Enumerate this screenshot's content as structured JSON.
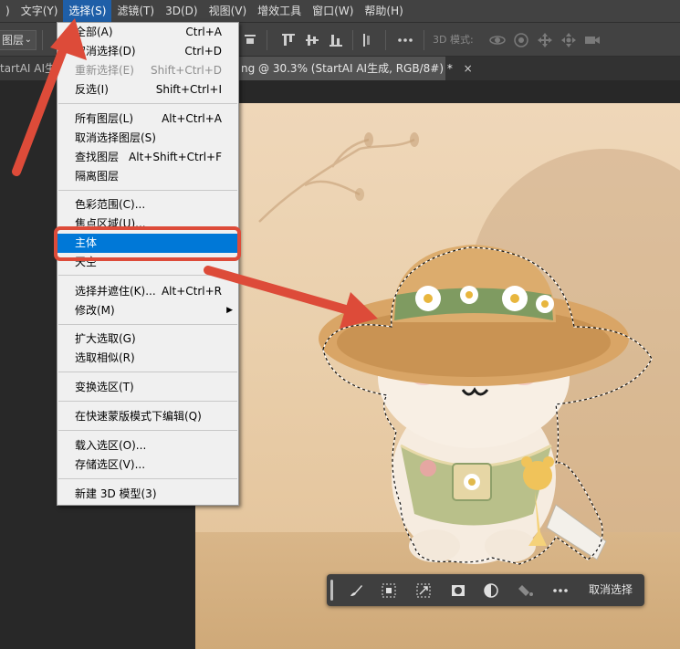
{
  "menubar": {
    "items": [
      {
        "label": ")"
      },
      {
        "label": "文字(Y)"
      },
      {
        "label": "选择(S)"
      },
      {
        "label": "滤镜(T)"
      },
      {
        "label": "3D(D)"
      },
      {
        "label": "视图(V)"
      },
      {
        "label": "增效工具"
      },
      {
        "label": "窗口(W)"
      },
      {
        "label": "帮助(H)"
      }
    ]
  },
  "options_bar": {
    "layer_select": "图层",
    "mode_3d_label": "3D 模式:"
  },
  "tabs": [
    {
      "label": "tartAI AI生"
    },
    {
      "label": "ng @ 30.3% (StartAI AI生成, RGB/8#) *",
      "close": "×"
    }
  ],
  "select_menu": {
    "items": [
      {
        "label": "全部(A)",
        "shortcut": "Ctrl+A"
      },
      {
        "label": "取消选择(D)",
        "shortcut": "Ctrl+D"
      },
      {
        "label": "重新选择(E)",
        "shortcut": "Shift+Ctrl+D"
      },
      {
        "label": "反选(I)",
        "shortcut": "Shift+Ctrl+I"
      },
      {
        "label": "所有图层(L)",
        "shortcut": "Alt+Ctrl+A"
      },
      {
        "label": "取消选择图层(S)",
        "shortcut": ""
      },
      {
        "label": "查找图层",
        "shortcut": "Alt+Shift+Ctrl+F"
      },
      {
        "label": "隔离图层",
        "shortcut": ""
      },
      {
        "label": "色彩范围(C)...",
        "shortcut": ""
      },
      {
        "label": "焦点区域(U)...",
        "shortcut": ""
      },
      {
        "label": "主体",
        "shortcut": ""
      },
      {
        "label": "天空",
        "shortcut": ""
      },
      {
        "label": "选择并遮住(K)...",
        "shortcut": "Alt+Ctrl+R"
      },
      {
        "label": "修改(M)",
        "shortcut": ""
      },
      {
        "label": "扩大选取(G)",
        "shortcut": ""
      },
      {
        "label": "选取相似(R)",
        "shortcut": ""
      },
      {
        "label": "变换选区(T)",
        "shortcut": ""
      },
      {
        "label": "在快速蒙版模式下编辑(Q)",
        "shortcut": ""
      },
      {
        "label": "载入选区(O)...",
        "shortcut": ""
      },
      {
        "label": "存储选区(V)...",
        "shortcut": ""
      },
      {
        "label": "新建 3D 模型(3)",
        "shortcut": ""
      }
    ]
  },
  "taskbar": {
    "deselect_label": "取消选择"
  },
  "colors": {
    "annotation_red": "#dd4b39",
    "menu_highlight": "#0078d7",
    "ui_panel": "#424242"
  },
  "icons": {
    "brush": "brush-icon",
    "mask": "mask-icon",
    "transform": "transform-icon",
    "fill": "fill-icon",
    "more": "more-icon"
  }
}
